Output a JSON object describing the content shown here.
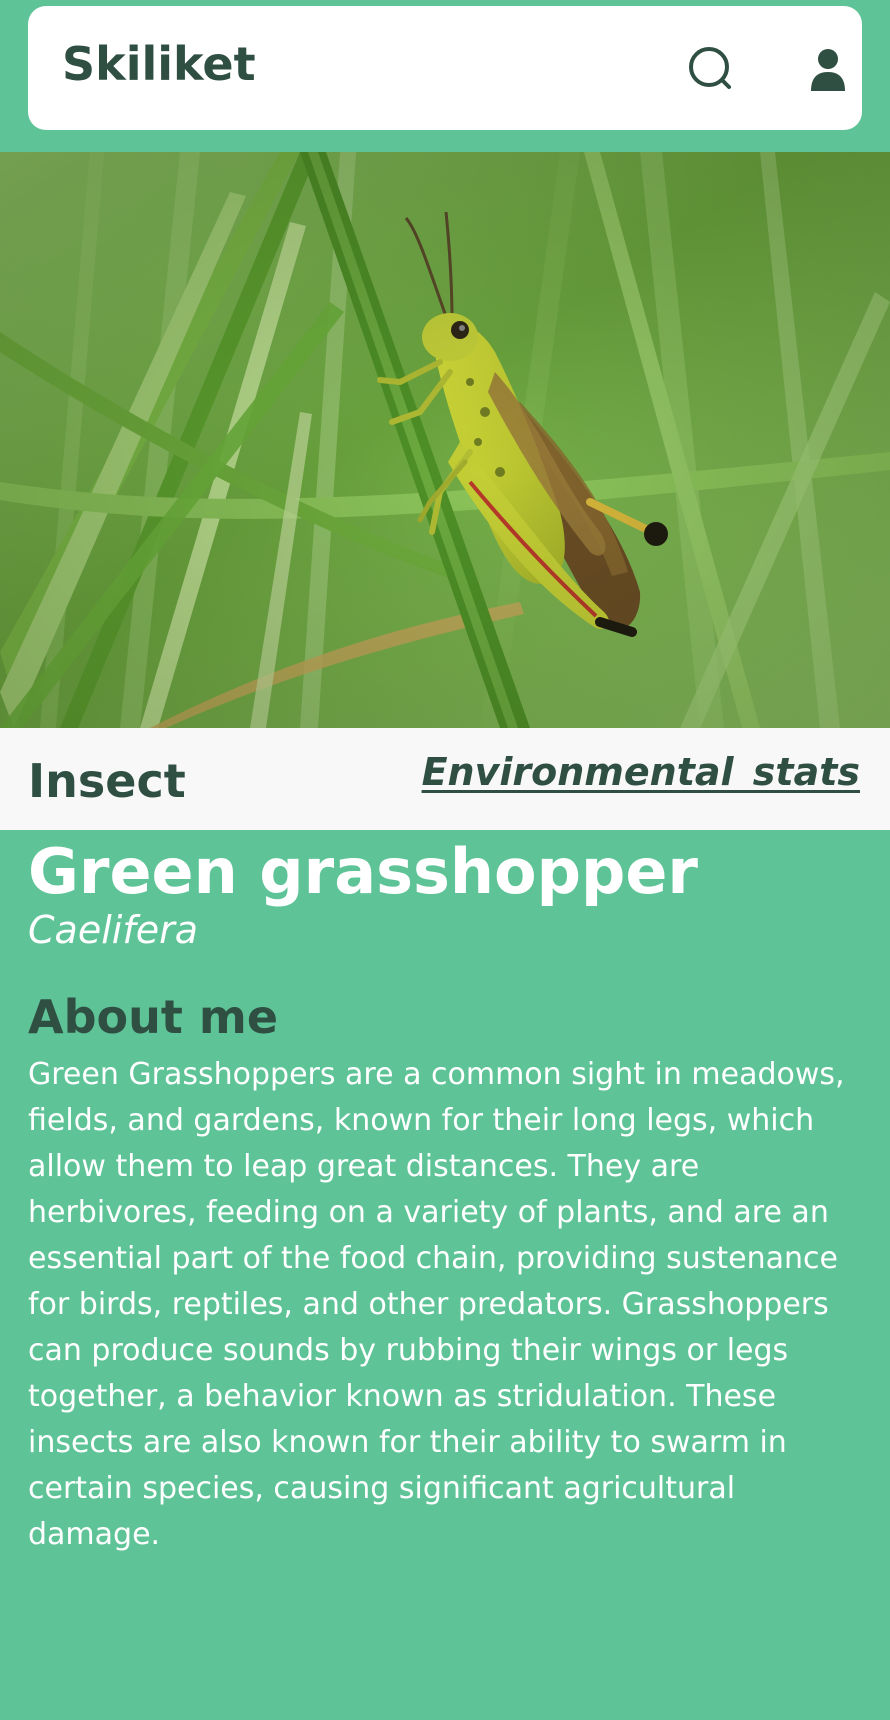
{
  "header": {
    "app_title": "Skiliket",
    "icons": {
      "search": "search-icon",
      "profile": "user-icon"
    }
  },
  "hero": {
    "image_description": "green grasshopper-photo"
  },
  "category_bar": {
    "category": "Insect",
    "link_label": "Environmental  stats"
  },
  "species": {
    "common_name": "Green grasshopper",
    "scientific_name": "Caelifera"
  },
  "about": {
    "heading": "About me",
    "text": "Green Grasshoppers are a common sight in meadows, fields, and gardens, known for their long legs, which allow them to leap great distances. They are herbivores, feeding on a variety of plants, and are an essential part of the food chain, providing sustenance for birds, reptiles, and other predators. Grasshoppers can produce sounds by rubbing their wings or legs together, a behavior known as stridulation. These insects are also known for their ability to swarm in certain species, causing significant agricultural damage."
  },
  "colors": {
    "background": "#5ec497",
    "header_card": "#ffffff",
    "dark_text": "#2f4f43",
    "light_text": "#ffffff",
    "category_bar": "#f8f8f8"
  }
}
